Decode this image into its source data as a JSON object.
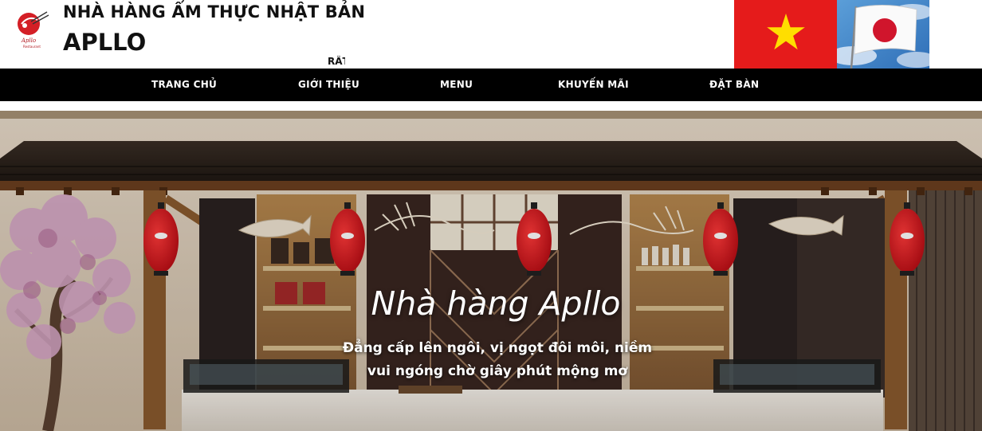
{
  "header": {
    "title_line1": "NHÀ HÀNG ẨM THỰC NHẬT BẢN",
    "title_line2": "APLLO",
    "marquee_text": "RẤT",
    "logo_text": "Apllo",
    "logo_subtext": "Restaurant"
  },
  "nav": {
    "items": [
      {
        "label": "TRANG CHỦ"
      },
      {
        "label": "GIỚI THIỆU"
      },
      {
        "label": "MENU"
      },
      {
        "label": "KHUYẾN MÃI"
      },
      {
        "label": "ĐẶT BÀN"
      }
    ]
  },
  "hero": {
    "title": "Nhà hàng Apllo",
    "subtitle": "Đẳng cấp lên ngôi, vị ngọt đôi môi, niềm vui ngóng chờ giây phút mộng mơ"
  },
  "colors": {
    "nav_bg": "#000000",
    "vn_flag_red": "#e51b1b",
    "vn_flag_star": "#ffde00",
    "jp_flag_red": "#d0152c",
    "lantern_red": "#e1101c"
  }
}
